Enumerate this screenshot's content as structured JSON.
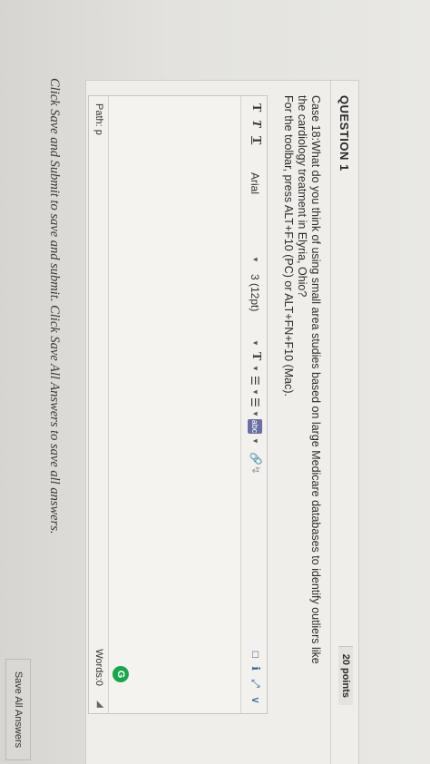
{
  "question": {
    "title": "QUESTION 1",
    "points": "20 points",
    "text_line1": "Case 18:What do you think of using small area studies based on large Medicare databases to identify outliers like",
    "text_line2": "the cardiology treatment in Elyria, Ohio?",
    "toolbar_hint": "For the toolbar, press ALT+F10 (PC) or ALT+FN+F10 (Mac)."
  },
  "toolbar": {
    "format_t1": "T",
    "format_t2": "T",
    "format_t3": "T",
    "font_family": "Arial",
    "font_size": "3 (12pt)",
    "text_color": "T",
    "bullets": "☰",
    "numbering": "☰",
    "spellcheck": "abc"
  },
  "editor": {
    "path": "Path: p",
    "words": "Words:0"
  },
  "footer": {
    "instructions": "Click Save and Submit to save and submit. Click Save All Answers to save all answers.",
    "save_all_label": "Save All Answers"
  }
}
